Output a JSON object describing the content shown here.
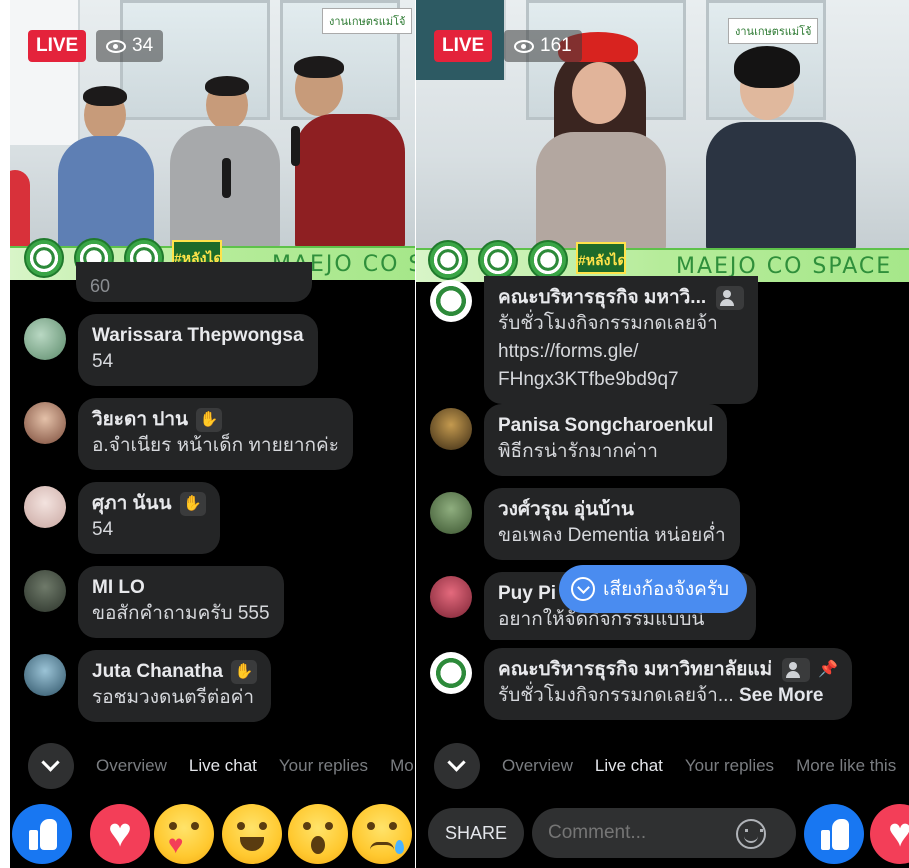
{
  "colors": {
    "live": "#e4233b",
    "bubble": "#242526",
    "accent": "#4a8cf0",
    "like": "#1877f2",
    "love": "#f33e58",
    "banner": "#a6e78a"
  },
  "left": {
    "live_label": "LIVE",
    "viewer_count": "34",
    "banner_tag": "#หลังไดม",
    "banner_text": "MAEJO CO SPACE",
    "corner_logo": "งานเกษตรแม่โจ้",
    "partial_message": "60",
    "messages": [
      {
        "name": "Warissara Thepwongsa",
        "text": "54",
        "icon": ""
      },
      {
        "name": "วิยะดา ปาน",
        "text": "อ.จำเนียร หน้าเด็ก ทายยากค่ะ",
        "icon": "wave-icon"
      },
      {
        "name": "ศุภา นันน",
        "text": "54",
        "icon": "wave-icon"
      },
      {
        "name": "MI LO",
        "text": "ขอสักคำถามครับ 555",
        "icon": ""
      },
      {
        "name": "Juta Chanatha",
        "text": "รอชมวงดนตรีต่อค่า",
        "icon": "wave-icon"
      }
    ],
    "tabs": [
      "Overview",
      "Live chat",
      "Your replies",
      "Mo"
    ],
    "active_tab": "Live chat"
  },
  "right": {
    "live_label": "LIVE",
    "viewer_count": "161",
    "banner_tag": "#หลังไดม",
    "banner_text": "MAEJO CO SPACE",
    "corner_logo": "งานเกษตรแม่โจ้",
    "top_message": {
      "name": "คณะบริหารธุรกิจ มหาวิ...",
      "lines": [
        "รับชั่วโมงกิจกรรมกดเลยจ้า",
        "https://forms.gle/",
        "FHngx3KTfbe9bd9q7"
      ],
      "icon": "admin-icon"
    },
    "messages": [
      {
        "name": "Panisa Songcharoenkul",
        "text": "พิธีกรน่ารักมากค่าา"
      },
      {
        "name": "วงศ์วรุณ อุ่นบ้าน",
        "text": "ขอเพลง Dementia หน่อยค่ำ"
      },
      {
        "name": "Puy Pi",
        "text": "อยากให้จัดกิจกรรมแบบนี"
      }
    ],
    "new_message_pill": "เสียงก้องจังครับ",
    "pinned": {
      "name": "คณะบริหารธุรกิจ มหาวิทยาลัยแม่",
      "text": "รับชั่วโมงกิจกรรมกดเลยจ้า...",
      "see_more": "See More"
    },
    "tabs": [
      "Overview",
      "Live chat",
      "Your replies",
      "More like this"
    ],
    "active_tab": "Live chat",
    "share_label": "SHARE",
    "comment_placeholder": "Comment..."
  }
}
